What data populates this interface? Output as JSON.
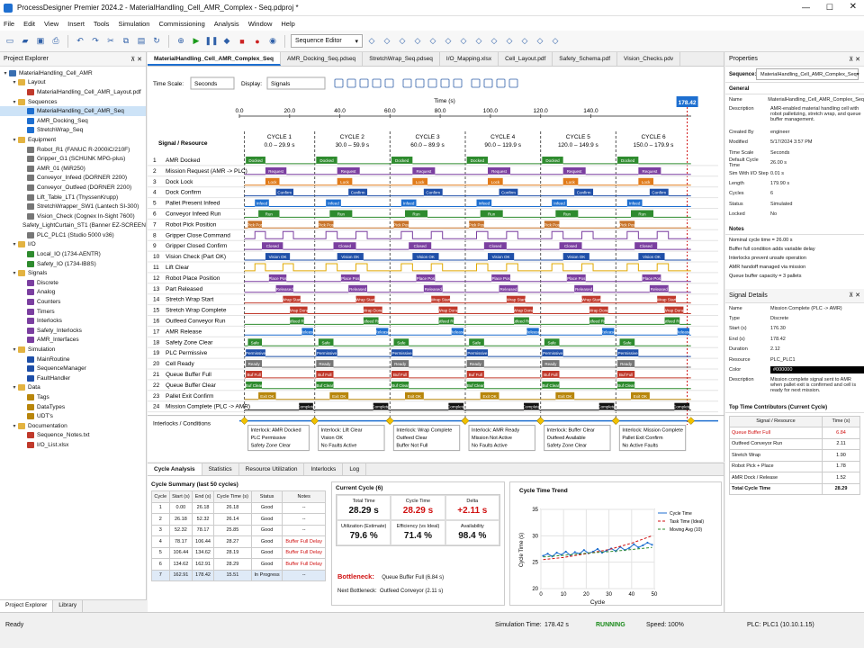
{
  "app": {
    "title": "ProcessDesigner Premier 2024.2 - MaterialHandling_Cell_AMR_Complex - Seq.pdproj *"
  },
  "menu": [
    "File",
    "Edit",
    "View",
    "Insert",
    "Tools",
    "Simulation",
    "Commissioning",
    "Analysis",
    "Window",
    "Help"
  ],
  "toolbar": {
    "editor_select": "Sequence Editor"
  },
  "explorer": {
    "title": "Project Explorer",
    "tabs": [
      "Project Explorer",
      "Library"
    ],
    "tree": [
      {
        "d": 0,
        "t": "MaterialHandling_Cell_AMR",
        "k": "root"
      },
      {
        "d": 1,
        "t": "Layout",
        "k": "folder"
      },
      {
        "d": 2,
        "t": "MaterialHandling_Cell_AMR_Layout.pdf",
        "k": "file"
      },
      {
        "d": 1,
        "t": "Sequences",
        "k": "folder"
      },
      {
        "d": 2,
        "t": "MaterialHandling_Cell_AMR_Seq",
        "k": "seq",
        "sel": true
      },
      {
        "d": 2,
        "t": "AMR_Docking_Seq",
        "k": "seq"
      },
      {
        "d": 2,
        "t": "StretchWrap_Seq",
        "k": "seq"
      },
      {
        "d": 1,
        "t": "Equipment",
        "k": "folder"
      },
      {
        "d": 2,
        "t": "Robot_R1 (FANUC R-2000iC/210F)",
        "k": "eq"
      },
      {
        "d": 2,
        "t": "Gripper_G1 (SCHUNK MPG-plus)",
        "k": "eq"
      },
      {
        "d": 2,
        "t": "AMR_01 (MiR250)",
        "k": "eq"
      },
      {
        "d": 2,
        "t": "Conveyor_Infeed (DORNER 2200)",
        "k": "eq"
      },
      {
        "d": 2,
        "t": "Conveyor_Outfeed (DORNER 2200)",
        "k": "eq"
      },
      {
        "d": 2,
        "t": "Lift_Table_LT1 (ThyssenKrupp)",
        "k": "eq"
      },
      {
        "d": 2,
        "t": "StretchWrapper_SW1 (Lantech SI-300)",
        "k": "eq"
      },
      {
        "d": 2,
        "t": "Vision_Check (Cognex In-Sight 7600)",
        "k": "eq"
      },
      {
        "d": 2,
        "t": "Safety_LightCurtain_ST1 (Banner EZ-SCREEN)",
        "k": "eq"
      },
      {
        "d": 2,
        "t": "PLC_PLC1 (Studio 5000 v36)",
        "k": "eq"
      },
      {
        "d": 1,
        "t": "I/O",
        "k": "folder"
      },
      {
        "d": 2,
        "t": "Local_IO (1734-AENTR)",
        "k": "io"
      },
      {
        "d": 2,
        "t": "Safety_IO (1734-IB8S)",
        "k": "io"
      },
      {
        "d": 1,
        "t": "Signals",
        "k": "folder"
      },
      {
        "d": 2,
        "t": "Discrete",
        "k": "sig"
      },
      {
        "d": 2,
        "t": "Analog",
        "k": "sig"
      },
      {
        "d": 2,
        "t": "Counters",
        "k": "sig"
      },
      {
        "d": 2,
        "t": "Timers",
        "k": "sig"
      },
      {
        "d": 2,
        "t": "Interlocks",
        "k": "sig"
      },
      {
        "d": 2,
        "t": "Safety_Interlocks",
        "k": "sig"
      },
      {
        "d": 2,
        "t": "AMR_Interfaces",
        "k": "sig"
      },
      {
        "d": 1,
        "t": "Simulation",
        "k": "folder"
      },
      {
        "d": 2,
        "t": "MainRoutine",
        "k": "sim"
      },
      {
        "d": 2,
        "t": "SequenceManager",
        "k": "sim"
      },
      {
        "d": 2,
        "t": "FaultHandler",
        "k": "sim"
      },
      {
        "d": 1,
        "t": "Data",
        "k": "folder"
      },
      {
        "d": 2,
        "t": "Tags",
        "k": "data"
      },
      {
        "d": 2,
        "t": "DataTypes",
        "k": "data"
      },
      {
        "d": 2,
        "t": "UDT's",
        "k": "data"
      },
      {
        "d": 1,
        "t": "Documentation",
        "k": "folder"
      },
      {
        "d": 2,
        "t": "Sequence_Notes.txt",
        "k": "file"
      },
      {
        "d": 2,
        "t": "I/O_List.xlsx",
        "k": "file"
      }
    ]
  },
  "doctabs": [
    "MaterialHandling_Cell_AMR_Complex_Seq",
    "AMR_Docking_Seq.pdseq",
    "StretchWrap_Seq.pdseq",
    "I/O_Mapping.xlsx",
    "Cell_Layout.pdf",
    "Safety_Schema.pdf",
    "Vision_Checks.pdv"
  ],
  "timing": {
    "time_scale_label": "Time Scale:",
    "time_scale": "Seconds",
    "display_label": "Display:",
    "display": "Signals",
    "axis_title": "Time (s)",
    "axis_ticks": [
      "0.0",
      "20.0",
      "40.0",
      "60.0",
      "80.0",
      "100.0",
      "120.0",
      "140.0"
    ],
    "cursor": "178.42",
    "header_label": "Signal / Resource",
    "cycles": [
      {
        "n": "CYCLE 1",
        "r": "0.0 – 29.9 s"
      },
      {
        "n": "CYCLE 2",
        "r": "30.0 – 59.9 s"
      },
      {
        "n": "CYCLE 3",
        "r": "60.0 – 89.9 s"
      },
      {
        "n": "CYCLE 4",
        "r": "90.0 – 119.9 s"
      },
      {
        "n": "CYCLE 5",
        "r": "120.0 – 149.9 s"
      },
      {
        "n": "CYCLE 6",
        "r": "150.0 – 179.9 s"
      }
    ],
    "signals": [
      {
        "n": "1",
        "name": "AMR Docked",
        "lbl": "Docked",
        "color": "#2e8b2e"
      },
      {
        "n": "2",
        "name": "Mission Request (AMR -> PLC)",
        "lbl": "Request",
        "color": "#7b3fa0"
      },
      {
        "n": "3",
        "name": "Dock Lock",
        "lbl": "Lock",
        "color": "#e07b1a"
      },
      {
        "n": "4",
        "name": "Dock Confirm",
        "lbl": "Confirm",
        "color": "#1f4fa8"
      },
      {
        "n": "5",
        "name": "Pallet Present Infeed",
        "lbl": "Infeed",
        "color": "#1e6fd0"
      },
      {
        "n": "6",
        "name": "Conveyor Infeed Run",
        "lbl": "Run",
        "color": "#2e8b2e"
      },
      {
        "n": "7",
        "name": "Robot Pick Position",
        "lbl": "Pick Pos",
        "color": "#c8742a"
      },
      {
        "n": "8",
        "name": "Gripper Close Command",
        "lbl": "",
        "color": "#7b3fa0"
      },
      {
        "n": "9",
        "name": "Gripper Closed Confirm",
        "lbl": "Closed",
        "color": "#7b3fa0"
      },
      {
        "n": "10",
        "name": "Vision Check (Part OK)",
        "lbl": "Vision OK",
        "color": "#1f4fa8"
      },
      {
        "n": "11",
        "name": "Lift Clear",
        "lbl": "",
        "color": "#e0a800"
      },
      {
        "n": "12",
        "name": "Robot Place Position",
        "lbl": "Place Pos",
        "color": "#7b3fa0"
      },
      {
        "n": "13",
        "name": "Part Released",
        "lbl": "Released",
        "color": "#7b3fa0"
      },
      {
        "n": "14",
        "name": "Stretch Wrap Start",
        "lbl": "Wrap Start",
        "color": "#c0392b"
      },
      {
        "n": "15",
        "name": "Stretch Wrap Complete",
        "lbl": "Wrap Done",
        "color": "#c0392b"
      },
      {
        "n": "16",
        "name": "Outfeed Conveyor Run",
        "lbl": "Outfeed Run",
        "color": "#2e8b2e"
      },
      {
        "n": "17",
        "name": "AMR Release",
        "lbl": "Release",
        "color": "#1e6fd0"
      },
      {
        "n": "18",
        "name": "Safety Zone Clear",
        "lbl": "Safe",
        "color": "#2e8b2e"
      },
      {
        "n": "19",
        "name": "PLC Permissive",
        "lbl": "Permissive",
        "color": "#1f4fa8"
      },
      {
        "n": "20",
        "name": "Cell Ready",
        "lbl": "Ready",
        "color": "#777777"
      },
      {
        "n": "21",
        "name": "Queue Buffer Full",
        "lbl": "Buf Full",
        "color": "#c0392b"
      },
      {
        "n": "22",
        "name": "Queue Buffer Clear",
        "lbl": "Buf Clear",
        "color": "#2e8b2e"
      },
      {
        "n": "23",
        "name": "Pallet Exit Confirm",
        "lbl": "Exit OK",
        "color": "#b8860b"
      },
      {
        "n": "24",
        "name": "Mission Complete (PLC -> AMR)",
        "lbl": "Complete",
        "color": "#111111"
      }
    ],
    "interlocks_label": "Interlocks / Conditions",
    "interlocks": [
      [
        "Interlock: AMR Docked",
        "PLC Permissive",
        "Safety Zone Clear"
      ],
      [
        "Interlock: Lift Clear",
        "Vision OK",
        "No Faults Active"
      ],
      [
        "Interlock: Wrap Complete",
        "Outfeed Clear",
        "Buffer Not Full"
      ],
      [
        "Interlock: AMR Ready",
        "Mission Not Active",
        "No Faults Active"
      ],
      [
        "Interlock: Buffer Clear",
        "Outfeed Available",
        "Safety Zone Clear"
      ],
      [
        "Interlock: Mission Complete",
        "Pallet Exit Confirm",
        "No Active Faults"
      ]
    ]
  },
  "analysis": {
    "tabs": [
      "Cycle Analysis",
      "Statistics",
      "Resource Utilization",
      "Interlocks",
      "Log"
    ],
    "summary_title": "Cycle Summary (last 50 cycles)",
    "summary_cols": [
      "Cycle",
      "Start (s)",
      "End (s)",
      "Cycle Time (s)",
      "Status",
      "Notes"
    ],
    "summary_rows": [
      [
        "1",
        "0.00",
        "26.18",
        "26.18",
        "Good",
        "--"
      ],
      [
        "2",
        "26.18",
        "52.32",
        "26.14",
        "Good",
        "--"
      ],
      [
        "3",
        "52.32",
        "78.17",
        "25.85",
        "Good",
        "--"
      ],
      [
        "4",
        "78.17",
        "106.44",
        "28.27",
        "Good",
        "Buffer Full Delay"
      ],
      [
        "5",
        "106.44",
        "134.62",
        "28.19",
        "Good",
        "Buffer Full Delay"
      ],
      [
        "6",
        "134.62",
        "162.91",
        "28.29",
        "Good",
        "Buffer Full Delay"
      ],
      [
        "7",
        "162.91",
        "178.42",
        "15.51",
        "In Progress",
        "--"
      ]
    ],
    "current_title": "Current Cycle (6)",
    "metrics": [
      {
        "l": "Total Time",
        "v": "28.29 s",
        "c": "#111111"
      },
      {
        "l": "Cycle Time",
        "v": "28.29 s",
        "c": "#d01010"
      },
      {
        "l": "Delta",
        "v": "+2.11 s",
        "c": "#d01010"
      },
      {
        "l": "Utilization (Estimate)",
        "v": "79.6 %",
        "c": "#111111"
      },
      {
        "l": "Efficiency (vs Ideal)",
        "v": "71.4 %",
        "c": "#111111"
      },
      {
        "l": "Availability",
        "v": "98.4 %",
        "c": "#111111"
      }
    ],
    "bottleneck_label": "Bottleneck:",
    "bottleneck": "Queue Buffer Full (6.84 s)",
    "next_label": "Next Bottleneck:",
    "next": "Outfeed Conveyor (2.11 s)",
    "trend_title": "Cycle Time Trend",
    "trend_ylabel": "Cycle Time (s)",
    "trend_xlabel": "Cycle"
  },
  "chart_data": {
    "type": "line",
    "title": "Cycle Time Trend",
    "xlabel": "Cycle",
    "ylabel": "Cycle Time (s)",
    "xlim": [
      0,
      50
    ],
    "ylim": [
      20,
      35
    ],
    "xticks": [
      "0",
      "10",
      "20",
      "30",
      "40",
      "50"
    ],
    "yticks": [
      "20",
      "25",
      "30",
      "35"
    ],
    "series": [
      {
        "name": "Cycle Time",
        "color": "#1e6fd0",
        "x": [
          1,
          3,
          5,
          7,
          9,
          11,
          13,
          15,
          17,
          19,
          21,
          23,
          25,
          27,
          29,
          31,
          33,
          35,
          37,
          39,
          41,
          43,
          45,
          47,
          49
        ],
        "values": [
          26.2,
          26.6,
          26.1,
          26.8,
          26.4,
          27.0,
          26.3,
          26.9,
          26.6,
          27.3,
          26.7,
          27.0,
          27.5,
          26.8,
          27.2,
          27.6,
          27.1,
          27.9,
          27.3,
          27.7,
          28.4,
          27.8,
          28.2,
          28.7,
          28.3
        ]
      },
      {
        "name": "Task Time (Ideal)",
        "color": "#d01010",
        "x": [
          1,
          10,
          20,
          30,
          40,
          49
        ],
        "values": [
          25.5,
          25.9,
          26.6,
          27.4,
          28.6,
          30.0
        ]
      },
      {
        "name": "Moving Avg (10)",
        "color": "#2e8b2e",
        "x": [
          1,
          10,
          20,
          30,
          40,
          49
        ],
        "values": [
          26.0,
          26.3,
          26.7,
          27.0,
          27.4,
          27.8
        ]
      }
    ]
  },
  "properties": {
    "title": "Properties",
    "seq_label": "Sequence:",
    "seq": "MaterialHandling_Cell_AMR_Complex_Seq",
    "general_title": "General",
    "general": [
      [
        "Name",
        "MaterialHandling_Cell_AMR_Complex_Seq"
      ],
      [
        "Description",
        "AMR-enabled material handling cell with robot palletizing, stretch wrap, and queue buffer management."
      ],
      [
        "Created By",
        "engineer"
      ],
      [
        "Modified",
        "5/17/2024 3:57 PM"
      ],
      [
        "Time Scale",
        "Seconds"
      ],
      [
        "Default Cycle Time",
        "26.00 s"
      ],
      [
        "Sim With I/O Step",
        "0.01 s"
      ],
      [
        "Length",
        "179.90 s"
      ],
      [
        "Cycles",
        "6"
      ],
      [
        "Status",
        "Simulated"
      ],
      [
        "Locked",
        "No"
      ]
    ],
    "notes_title": "Notes",
    "notes": [
      "Nominal cycle time = 26.00 s",
      "Buffer full condition adds variable delay",
      "Interlocks prevent unsafe operation",
      "AMR handoff managed via mission",
      "Queue buffer capacity = 3 pallets"
    ],
    "details_title": "Signal Details",
    "details": [
      [
        "Name",
        "Mission Complete (PLC -> AMR)"
      ],
      [
        "Type",
        "Discrete"
      ],
      [
        "Start (s)",
        "176.30"
      ],
      [
        "End (s)",
        "178.42"
      ],
      [
        "Duration",
        "2.12"
      ],
      [
        "Resource",
        "PLC_PLC1"
      ],
      [
        "Color",
        "#000000"
      ],
      [
        "Description",
        "Mission complete signal sent to AMR when pallet exit is confirmed and cell is ready for next mission."
      ]
    ],
    "top_title": "Top Time Contributors (Current Cycle)",
    "top_cols": [
      "Signal / Resource",
      "Time (s)"
    ],
    "top_rows": [
      [
        "Queue Buffer Full",
        "6.84"
      ],
      [
        "Outfeed Conveyor Run",
        "2.11"
      ],
      [
        "Stretch Wrap",
        "1.90"
      ],
      [
        "Robot Pick + Place",
        "1.78"
      ],
      [
        "AMR Dock / Release",
        "1.52"
      ],
      [
        "Total Cycle Time",
        "28.29"
      ]
    ]
  },
  "status": {
    "ready": "Ready",
    "sim_time_label": "Simulation Time:",
    "sim_time": "178.42 s",
    "running": "RUNNING",
    "speed_label": "Speed:",
    "speed": "100%",
    "plc": "PLC: PLC1 (10.10.1.15)"
  }
}
